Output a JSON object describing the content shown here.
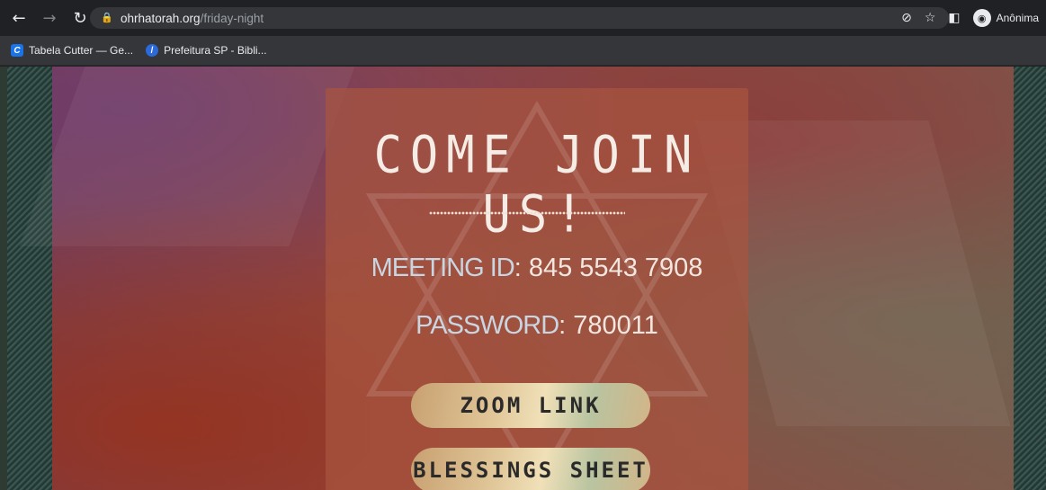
{
  "browser": {
    "url_domain": "ohrhatorah.org",
    "url_path": "/friday-night",
    "profile_label": "Anônima",
    "bookmarks": [
      {
        "label": "Tabela Cutter — Ge...",
        "icon": "C"
      },
      {
        "label": "Prefeitura SP - Bibli...",
        "icon": "A"
      }
    ]
  },
  "page": {
    "title": "COME JOIN US!",
    "meeting_label": "MEETING ID",
    "meeting_value": ": 845 5543 7908",
    "password_label": "PASSWORD",
    "password_value": ": 780011",
    "zoom_button": "ZOOM LINK",
    "blessings_button": "BLESSINGS SHEET"
  },
  "colors": {
    "chrome_bg": "#202124",
    "card_bg": "#a85440",
    "button_gold": "#e0c698"
  }
}
